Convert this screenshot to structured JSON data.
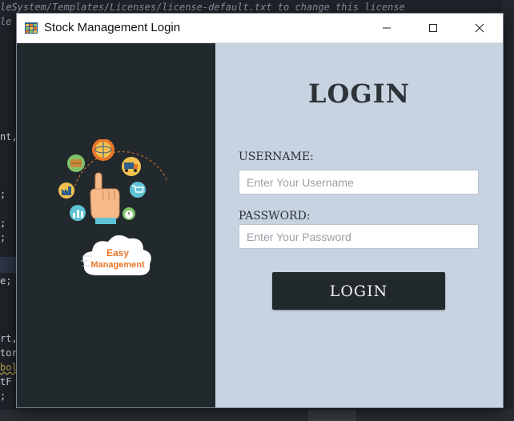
{
  "background_editor": {
    "lines": [
      {
        "text": "leSystem/Templates/Licenses/license-default.txt to change this license",
        "type": "comment"
      },
      {
        "text": "le",
        "type": "comment"
      },
      {
        "text": "nt,",
        "type": "code"
      },
      {
        "text": ";",
        "type": "code"
      },
      {
        "text": ";",
        "type": "code"
      },
      {
        "text": ";",
        "type": "code"
      },
      {
        "text": "e;",
        "type": "code"
      },
      {
        "text": "rt,",
        "type": "code"
      },
      {
        "text": "tor",
        "type": "code"
      },
      {
        "text": "bol",
        "type": "warn"
      },
      {
        "text": "tF",
        "type": "code"
      },
      {
        "text": ";",
        "type": "code"
      }
    ]
  },
  "window": {
    "title": "Stock Management Login",
    "controls": {
      "minimize": "minimize-icon",
      "maximize": "maximize-icon",
      "close": "close-icon"
    }
  },
  "illustration": {
    "cloud_line1": "Easy",
    "cloud_line2": "Management",
    "icons": [
      "globe-icon",
      "cart-icon",
      "truck-icon",
      "box-icon",
      "factory-icon",
      "chart-icon",
      "stopwatch-icon",
      "pointing-hand-icon",
      "cloud-icon"
    ]
  },
  "login": {
    "heading": "LOGIN",
    "username_label": "USERNAME:",
    "username_placeholder": "Enter Your Username",
    "password_label": "PASSWORD:",
    "password_placeholder": "Enter Your Password",
    "button_label": "LOGIN"
  },
  "colors": {
    "left_panel": "#22292d",
    "right_panel": "#c7d3e1",
    "button": "#22292d",
    "accent_orange": "#e8762a"
  }
}
